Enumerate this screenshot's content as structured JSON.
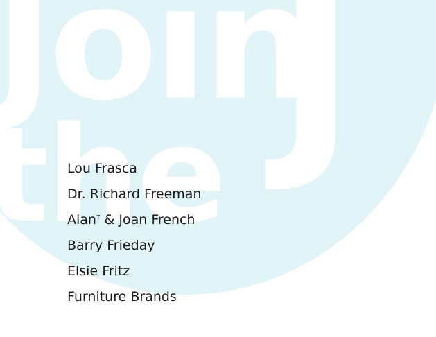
{
  "watermark": {
    "word1": "Join",
    "word2": "the",
    "word3": "J"
  },
  "donors": [
    {
      "name": "Lou Frasca",
      "mark": "",
      "rest": ""
    },
    {
      "name": "Dr. Richard Freeman",
      "mark": "",
      "rest": ""
    },
    {
      "name": "Alan",
      "mark": "†",
      "rest": " & Joan French"
    },
    {
      "name": "Barry Frieday",
      "mark": "",
      "rest": ""
    },
    {
      "name": "Elsie Fritz",
      "mark": "",
      "rest": ""
    },
    {
      "name": "Furniture Brands",
      "mark": "",
      "rest": ""
    }
  ],
  "colors": {
    "circle": "#e1f4f8",
    "text": "#1c1c1c"
  }
}
